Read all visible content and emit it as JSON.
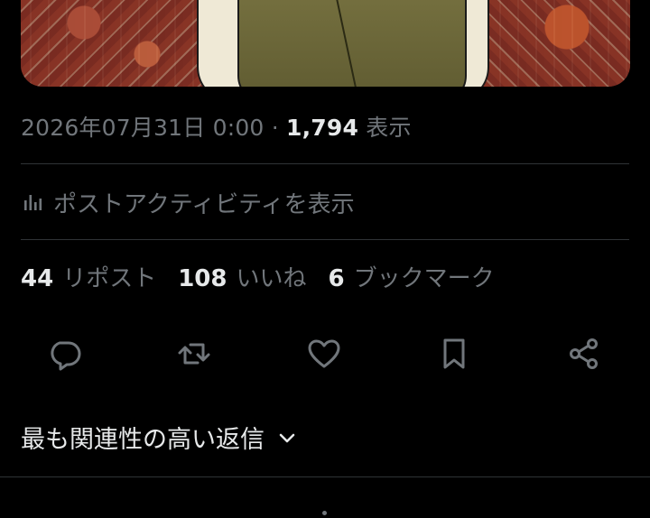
{
  "tweet": {
    "timestamp": "2026年07月31日 0:00",
    "separator": "·",
    "views_count": "1,794",
    "views_label": "表示"
  },
  "activity": {
    "label": "ポストアクティビティを表示",
    "icon": "bar-chart-icon"
  },
  "stats": {
    "reposts": {
      "count": "44",
      "label": "リポスト"
    },
    "likes": {
      "count": "108",
      "label": "いいね"
    },
    "bookmarks": {
      "count": "6",
      "label": "ブックマーク"
    }
  },
  "actions": [
    {
      "name": "reply",
      "icon": "speech-bubble-icon"
    },
    {
      "name": "repost",
      "icon": "repost-icon"
    },
    {
      "name": "like",
      "icon": "heart-icon"
    },
    {
      "name": "bookmark",
      "icon": "bookmark-icon"
    },
    {
      "name": "share",
      "icon": "share-icon"
    }
  ],
  "replies_sort": {
    "label": "最も関連性の高い返信",
    "icon": "chevron-down-icon"
  },
  "colors": {
    "background": "#000000",
    "primary_text": "#e7e9ea",
    "secondary_text": "#71767b",
    "divider": "#2f3336"
  }
}
